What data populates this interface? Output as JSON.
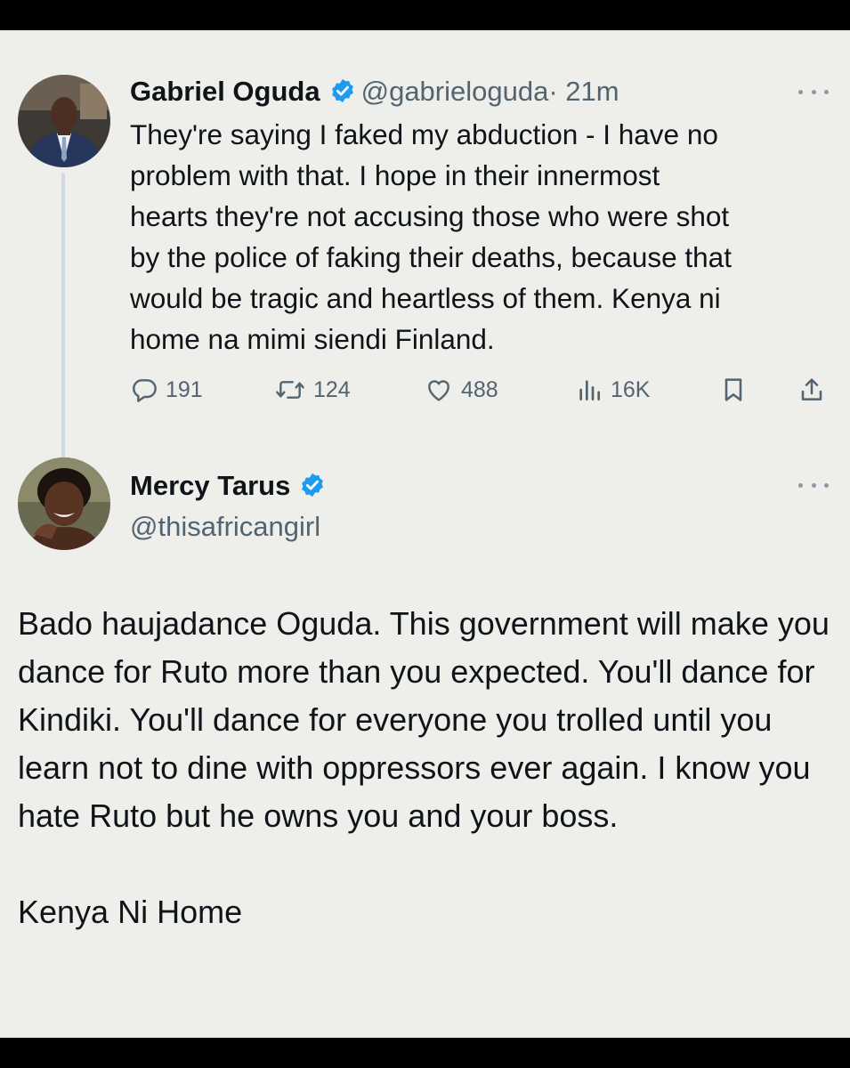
{
  "tweets": [
    {
      "author": "Gabriel Oguda",
      "handle": "@gabrieloguda",
      "time": "· 21m",
      "text": "They're saying I faked my abduction - I have no\nproblem with that. I hope in their innermost\nhearts they're not accusing those who were shot\nby the police of faking their deaths, because that\nwould be tragic and heartless of them. Kenya ni\nhome na mimi siendi Finland.",
      "stats": {
        "replies": "191",
        "reposts": "124",
        "likes": "488",
        "views": "16K"
      }
    },
    {
      "author": "Mercy Tarus",
      "handle": "@thisafricangirl",
      "paragraphs": [
        "Bado haujadance Oguda. This government will make you dance for Ruto more than you expected. You'll dance for Kindiki. You'll dance for everyone you trolled until you learn not to dine with oppressors ever again. I know you hate Ruto but he owns you and your boss.",
        "Kenya Ni Home"
      ]
    }
  ],
  "colors": {
    "background": "#eeeeea",
    "text": "#0f1419",
    "secondary": "#536471",
    "verified": "#1d9bf0",
    "thread_line": "#cfd9de"
  },
  "icons": [
    "verified-badge-icon",
    "more-icon",
    "reply-icon",
    "repost-icon",
    "like-icon",
    "views-icon",
    "bookmark-icon",
    "share-icon"
  ]
}
